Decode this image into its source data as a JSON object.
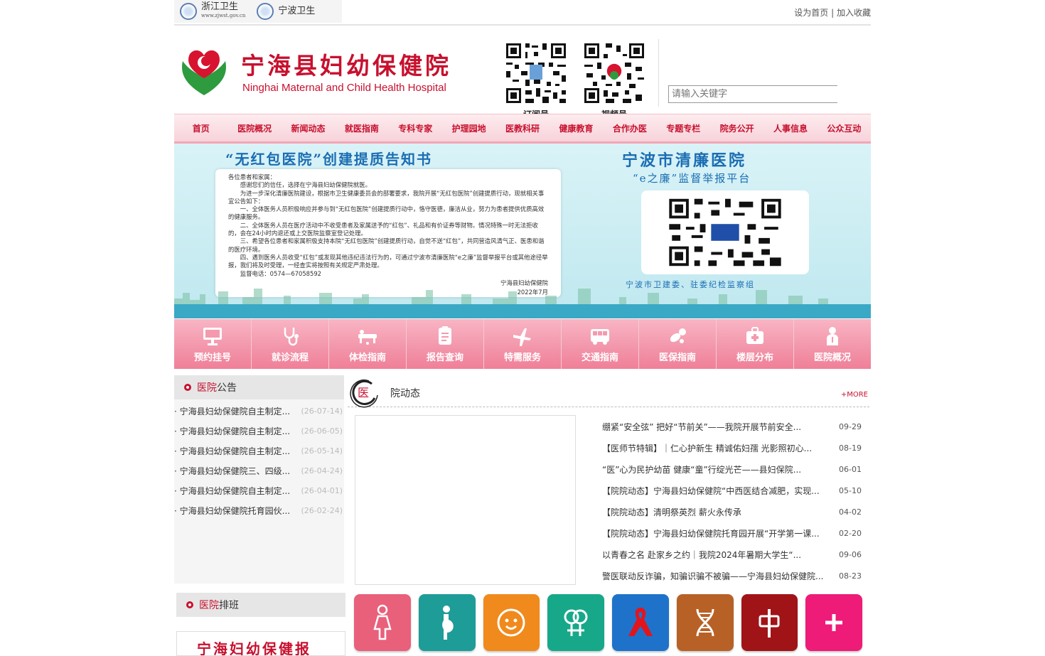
{
  "top": {
    "logo1_name": "浙江卫生",
    "logo1_url": "www.zjwst.gov.cn",
    "logo2_name": "宁波卫生",
    "links": [
      "设为首页",
      "加入收藏"
    ],
    "sep": "|"
  },
  "header": {
    "title_cn": "宁海县妇幼保健院",
    "title_en": "Ninghai Maternal and Child Health Hospital",
    "qr1_label": "订阅号",
    "qr2_label": "视频号",
    "search_placeholder": "请输入关键字"
  },
  "nav": [
    "首页",
    "医院概况",
    "新闻动态",
    "就医指南",
    "专科专家",
    "护理园地",
    "医教科研",
    "健康教育",
    "合作办医",
    "专题专栏",
    "院务公开",
    "人事信息",
    "公众互动"
  ],
  "banner": {
    "heading_left": "“无红包医院”创建提质告知书",
    "heading_right": "宁波市清廉医院",
    "subheading_right": "“e之廉”监督举报平台",
    "letter": [
      "各位患者和家属：",
      "感谢您们的信任，选择在宁海县妇幼保健院就医。",
      "为进一步深化清廉医院建设，根据市卫生健康委员会的部署要求，我院开展“无红包医院”创建提质行动，现就相关事宜公告如下：",
      "一、全体医务人员积极响应并参与到“无红包医院”创建提质行动中，恪守医德，廉洁从业，努力为患者提供优质高效的健康服务。",
      "二、全体医务人员在医疗活动中不收受患者及家属送予的“红包”、礼品和有价证券等财物。情况特殊一时无法拒收的，会在24小时内退还或上交医院监察室登记处理。",
      "三、希望各位患者和家属积极支持本院“无红包医院”创建提质行动，自觉不送“红包”，共同营造风清气正、医患和谐的医疗环境。",
      "四、遇到医务人员收受“红包”或发现其他违纪违法行为的，可通过宁波市清廉医院“e之廉”监督举报平台或其他途径举报，我们将及时受理，一经查实将按照有关规定严肃处理。",
      "监督电话：0574—67058592"
    ],
    "signature": "宁海县妇幼保健院",
    "sign_date": "2022年7月",
    "footer_right": "宁波市卫建委、驻委纪检监察组"
  },
  "quick": [
    {
      "label": "预约挂号",
      "icon": "monitor-icon"
    },
    {
      "label": "就诊流程",
      "icon": "stethoscope-icon"
    },
    {
      "label": "体检指南",
      "icon": "bed-icon"
    },
    {
      "label": "报告查询",
      "icon": "report-icon"
    },
    {
      "label": "特需服务",
      "icon": "plane-icon"
    },
    {
      "label": "交通指南",
      "icon": "bus-icon"
    },
    {
      "label": "医保指南",
      "icon": "pills-icon"
    },
    {
      "label": "楼层分布",
      "icon": "medkit-icon"
    },
    {
      "label": "医院概况",
      "icon": "doctor-icon"
    }
  ],
  "notice": {
    "title_red": "医院",
    "title_rest": "公告",
    "items": [
      {
        "text": "· 宁海县妇幼保健院自主制定...",
        "date": "(26-07-14)"
      },
      {
        "text": "· 宁海县妇幼保健院自主制定...",
        "date": "(26-06-05)"
      },
      {
        "text": "· 宁海县妇幼保健院自主制定...",
        "date": "(26-05-14)"
      },
      {
        "text": "· 宁海县妇幼保健院三、四级...",
        "date": "(26-04-24)"
      },
      {
        "text": "· 宁海县妇幼保健院自主制定...",
        "date": "(26-04-01)"
      },
      {
        "text": "· 宁海县妇幼保健院托育园伙...",
        "date": "(26-02-24)"
      }
    ]
  },
  "schedule": {
    "title_red": "医院",
    "title_rest": "排班",
    "image_text": "宁海妇幼保健报"
  },
  "news": {
    "badge_char": "医",
    "title": "院动态",
    "more": "+MORE",
    "items": [
      {
        "text": "绷紧“安全弦” 把好“节前关”——我院开展节前安全...",
        "date": "09-29"
      },
      {
        "text": "【医师节特辑】｜仁心护新生 精诚佑妇孺 光影照初心...",
        "date": "08-19"
      },
      {
        "text": "“医”心为民护幼苗 健康“童”行绽光芒——县妇保院...",
        "date": "06-01"
      },
      {
        "text": "【院院动态】宁海县妇幼保健院“中西医结合减肥，实现...",
        "date": "05-10"
      },
      {
        "text": "【院院动态】清明祭英烈 薪火永传承",
        "date": "04-02"
      },
      {
        "text": "【院院动态】宁海县妇幼保健院托育园开展“开学第一课...",
        "date": "02-20"
      },
      {
        "text": "以青春之名 赴家乡之约｜我院2024年暑期大学生“...",
        "date": "09-06"
      },
      {
        "text": "警医联动反诈骗，知骗识骗不被骗——宁海县妇幼保健院...",
        "date": "08-23"
      }
    ]
  },
  "tiles": [
    {
      "icon": "woman-icon",
      "color": "#e9607b"
    },
    {
      "icon": "pregnant-icon",
      "color": "#1e9c98"
    },
    {
      "icon": "baby-face-icon",
      "color": "#f08a1c"
    },
    {
      "icon": "gender-symbols-icon",
      "color": "#17a88a"
    },
    {
      "icon": "red-ribbon-icon",
      "color": "#1f72c9"
    },
    {
      "icon": "dna-icon",
      "color": "#b86127"
    },
    {
      "icon": "chinese-medicine-icon",
      "color": "#a01418"
    },
    {
      "icon": "plus-icon",
      "color": "#ee1b78"
    }
  ],
  "colors": {
    "brand_red": "#c8102e",
    "nav_pink": "#f7d3da",
    "banner_blue": "#1b6db3"
  }
}
